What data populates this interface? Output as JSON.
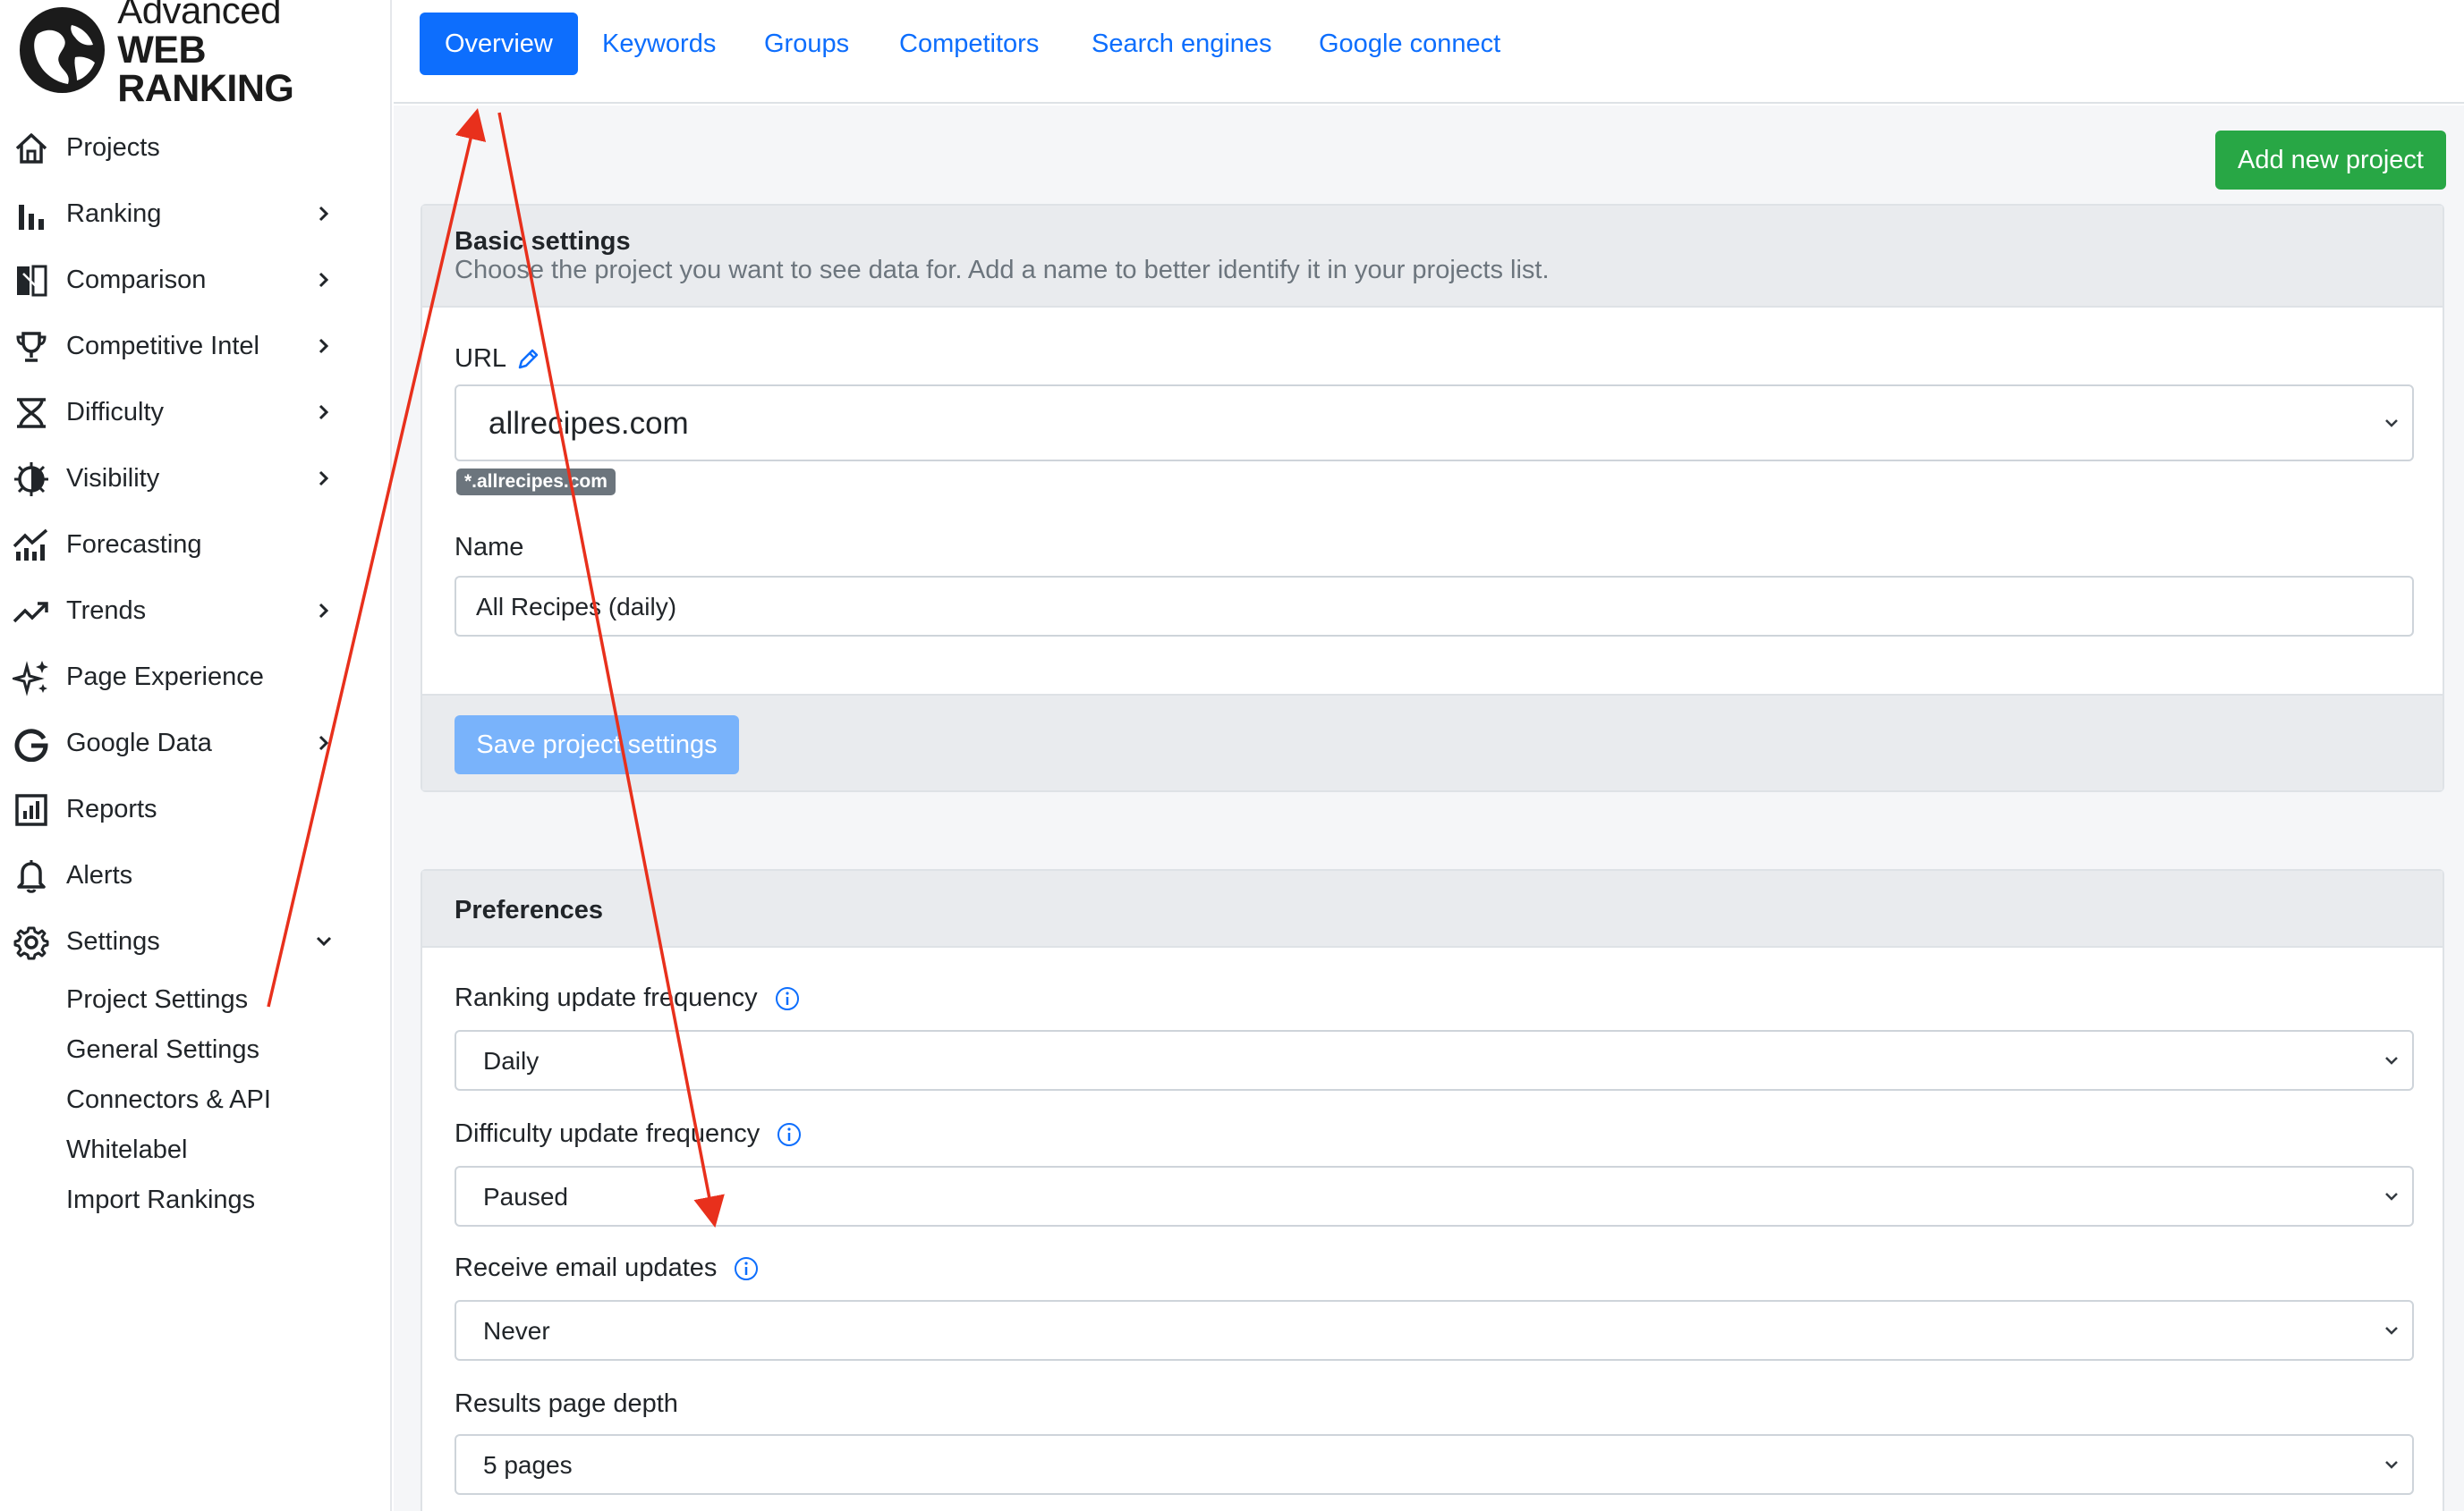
{
  "logo": {
    "line1": "Advanced",
    "line2": "WEB RANKING"
  },
  "sidebar": {
    "items": [
      {
        "label": "Projects",
        "icon": "home-icon",
        "chevron": false
      },
      {
        "label": "Ranking",
        "icon": "bar-chart-icon",
        "chevron": true
      },
      {
        "label": "Comparison",
        "icon": "compare-icon",
        "chevron": true
      },
      {
        "label": "Competitive Intel",
        "icon": "trophy-icon",
        "chevron": true
      },
      {
        "label": "Difficulty",
        "icon": "hourglass-icon",
        "chevron": true
      },
      {
        "label": "Visibility",
        "icon": "gear-eye-icon",
        "chevron": true
      },
      {
        "label": "Forecasting",
        "icon": "forecast-icon",
        "chevron": false
      },
      {
        "label": "Trends",
        "icon": "trend-icon",
        "chevron": true
      },
      {
        "label": "Page Experience",
        "icon": "sparkle-icon",
        "chevron": false
      },
      {
        "label": "Google Data",
        "icon": "google-icon",
        "chevron": true
      },
      {
        "label": "Reports",
        "icon": "report-icon",
        "chevron": false
      },
      {
        "label": "Alerts",
        "icon": "bell-icon",
        "chevron": false
      },
      {
        "label": "Settings",
        "icon": "gear-icon",
        "chevron": true
      }
    ],
    "settings_sub": [
      "Project Settings",
      "General Settings",
      "Connectors & API",
      "Whitelabel",
      "Import Rankings"
    ]
  },
  "tabs": [
    "Overview",
    "Keywords",
    "Groups",
    "Competitors",
    "Search engines",
    "Google connect"
  ],
  "active_tab": "Overview",
  "add_project_label": "Add new project",
  "basic": {
    "title": "Basic settings",
    "subtitle": "Choose the project you want to see data for. Add a name to better identify it in your projects list.",
    "url_label": "URL",
    "url_value": "allrecipes.com",
    "url_badge": "*.allrecipes.com",
    "name_label": "Name",
    "name_value": "All Recipes (daily)",
    "save_label": "Save project settings"
  },
  "prefs": {
    "title": "Preferences",
    "ranking_label": "Ranking update frequency",
    "ranking_value": "Daily",
    "difficulty_label": "Difficulty update frequency",
    "difficulty_value": "Paused",
    "email_label": "Receive email updates",
    "email_value": "Never",
    "depth_label": "Results page depth",
    "depth_value": "5 pages"
  },
  "colors": {
    "primary": "#0d6efd",
    "success": "#28a745",
    "annotation": "#e8301c"
  }
}
